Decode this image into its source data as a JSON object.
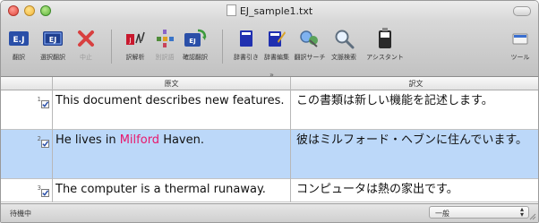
{
  "window": {
    "title": "EJ_sample1.txt"
  },
  "toolbar": {
    "buttons": [
      {
        "label": "翻訳",
        "icon": "ej-translate-icon"
      },
      {
        "label": "選択翻訳",
        "icon": "ej-select-translate-icon"
      },
      {
        "label": "中止",
        "icon": "stop-icon"
      },
      {
        "label": "訳解析",
        "icon": "analysis-icon"
      },
      {
        "label": "別訳語",
        "icon": "alternate-word-icon"
      },
      {
        "label": "確認翻訳",
        "icon": "confirm-translate-icon"
      },
      {
        "label": "辞書引き",
        "icon": "dictionary-lookup-icon"
      },
      {
        "label": "辞書編集",
        "icon": "dictionary-edit-icon"
      },
      {
        "label": "翻訳サーチ",
        "icon": "translation-search-icon"
      },
      {
        "label": "文脈検索",
        "icon": "context-search-icon"
      },
      {
        "label": "アシスタント",
        "icon": "assistant-icon"
      },
      {
        "label": "ツール",
        "icon": "tools-icon"
      }
    ],
    "overflow_mark": "»"
  },
  "table": {
    "header": {
      "source": "原文",
      "target": "訳文"
    },
    "rows": [
      {
        "num": "1",
        "checked": true,
        "source": "This document describes new features.",
        "target": "この書類は新しい機能を記述します。",
        "selected": false
      },
      {
        "num": "2",
        "checked": true,
        "source_pre": "He lives in ",
        "source_hl": "Milford",
        "source_post": " Haven.",
        "target": "彼はミルフォード・ヘブンに住んでいます。",
        "selected": true
      },
      {
        "num": "3",
        "checked": true,
        "source": "The computer is a thermal runaway.",
        "target": "コンピュータは熱の家出です。",
        "selected": false
      }
    ]
  },
  "statusbar": {
    "text": "待機中",
    "select_value": "一般"
  },
  "colors": {
    "selected_row": "#bcd8f9",
    "highlight_word": "#e8176b"
  }
}
